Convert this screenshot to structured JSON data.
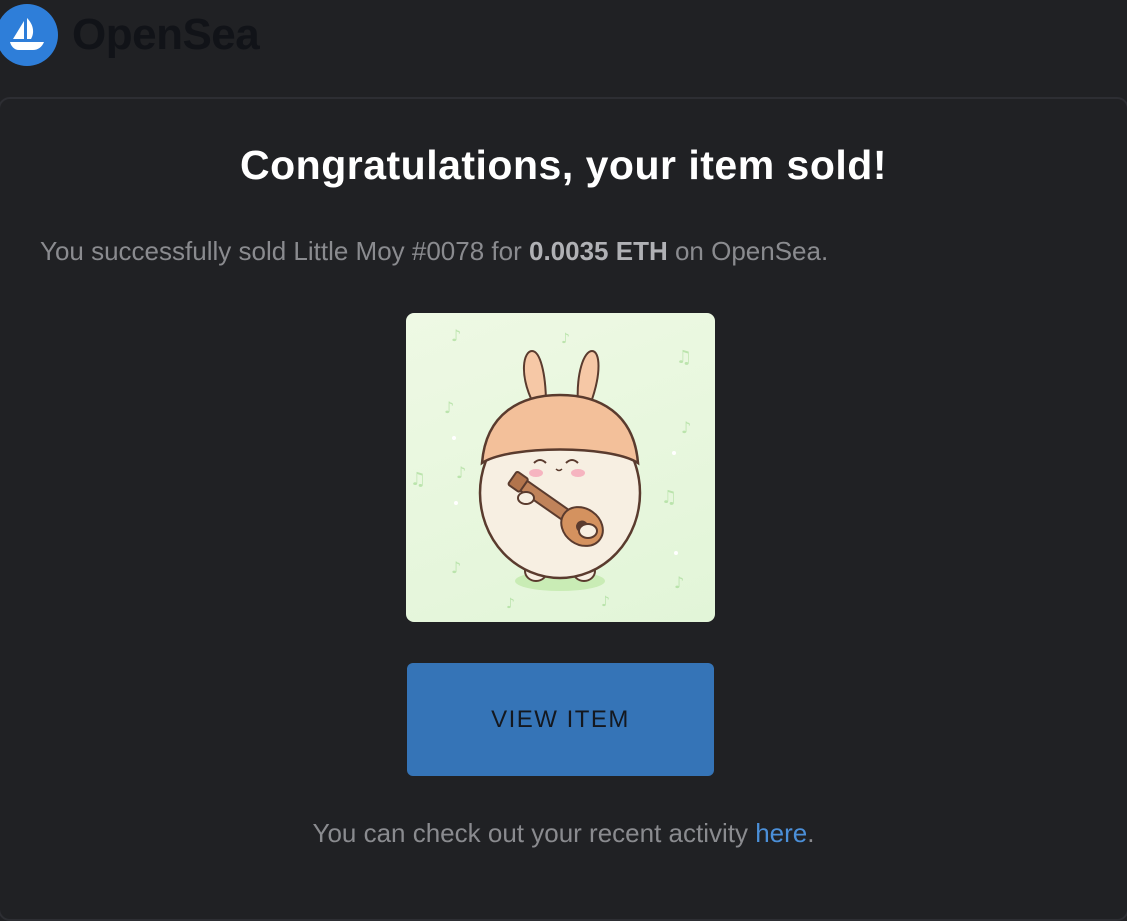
{
  "header": {
    "brand_name": "OpenSea",
    "logo_icon": "sailboat-icon",
    "brand_color": "#2e7ed9"
  },
  "main": {
    "title": "Congratulations, your item sold!",
    "message": {
      "prefix": "You successfully sold Little Moy #0078 for ",
      "price": "0.0035 ETH",
      "suffix": " on OpenSea."
    },
    "item_image": {
      "description_icon": "bunny-with-ukulele-illustration"
    },
    "view_button_label": "VIEW ITEM",
    "button_color": "#3574b7",
    "footer": {
      "prefix": "You can check out your recent activity ",
      "link_text": "here",
      "suffix": "."
    }
  }
}
